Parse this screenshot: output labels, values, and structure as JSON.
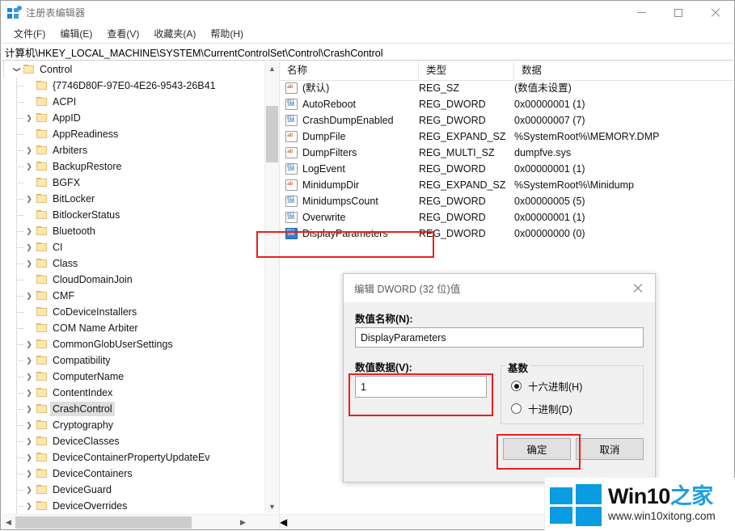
{
  "window": {
    "title": "注册表编辑器",
    "app_icon": "registry-editor-icon",
    "minimize_label": "最小化",
    "maximize_label": "最大化",
    "close_label": "关闭"
  },
  "menubar": {
    "items": [
      {
        "label": "文件(F)"
      },
      {
        "label": "编辑(E)"
      },
      {
        "label": "查看(V)"
      },
      {
        "label": "收藏夹(A)"
      },
      {
        "label": "帮助(H)"
      }
    ]
  },
  "address_bar": {
    "path": "计算机\\HKEY_LOCAL_MACHINE\\SYSTEM\\CurrentControlSet\\Control\\CrashControl"
  },
  "tree": {
    "root": {
      "label": "Control",
      "expanded": true,
      "chevron": "chevron-down-icon"
    },
    "items": [
      {
        "label": "{7746D80F-97E0-4E26-9543-26B41",
        "expandable": false,
        "selected": false
      },
      {
        "label": "ACPI",
        "expandable": false,
        "selected": false
      },
      {
        "label": "AppID",
        "expandable": true,
        "selected": false
      },
      {
        "label": "AppReadiness",
        "expandable": false,
        "selected": false
      },
      {
        "label": "Arbiters",
        "expandable": true,
        "selected": false
      },
      {
        "label": "BackupRestore",
        "expandable": true,
        "selected": false
      },
      {
        "label": "BGFX",
        "expandable": false,
        "selected": false
      },
      {
        "label": "BitLocker",
        "expandable": true,
        "selected": false
      },
      {
        "label": "BitlockerStatus",
        "expandable": false,
        "selected": false
      },
      {
        "label": "Bluetooth",
        "expandable": true,
        "selected": false
      },
      {
        "label": "CI",
        "expandable": true,
        "selected": false
      },
      {
        "label": "Class",
        "expandable": true,
        "selected": false
      },
      {
        "label": "CloudDomainJoin",
        "expandable": false,
        "selected": false
      },
      {
        "label": "CMF",
        "expandable": true,
        "selected": false
      },
      {
        "label": "CoDeviceInstallers",
        "expandable": false,
        "selected": false
      },
      {
        "label": "COM Name Arbiter",
        "expandable": false,
        "selected": false
      },
      {
        "label": "CommonGlobUserSettings",
        "expandable": true,
        "selected": false
      },
      {
        "label": "Compatibility",
        "expandable": true,
        "selected": false
      },
      {
        "label": "ComputerName",
        "expandable": true,
        "selected": false
      },
      {
        "label": "ContentIndex",
        "expandable": true,
        "selected": false
      },
      {
        "label": "CrashControl",
        "expandable": true,
        "selected": true
      },
      {
        "label": "Cryptography",
        "expandable": true,
        "selected": false
      },
      {
        "label": "DeviceClasses",
        "expandable": true,
        "selected": false
      },
      {
        "label": "DeviceContainerPropertyUpdateEv",
        "expandable": true,
        "selected": false
      },
      {
        "label": "DeviceContainers",
        "expandable": true,
        "selected": false
      },
      {
        "label": "DeviceGuard",
        "expandable": true,
        "selected": false
      },
      {
        "label": "DeviceOverrides",
        "expandable": true,
        "selected": false
      }
    ]
  },
  "values": {
    "columns": [
      {
        "label": "名称"
      },
      {
        "label": "类型"
      },
      {
        "label": "数据"
      }
    ],
    "rows": [
      {
        "name": "(默认)",
        "type": "REG_SZ",
        "data": "(数值未设置)",
        "icon": "string-value-icon",
        "selected": false
      },
      {
        "name": "AutoReboot",
        "type": "REG_DWORD",
        "data": "0x00000001 (1)",
        "icon": "dword-value-icon",
        "selected": false
      },
      {
        "name": "CrashDumpEnabled",
        "type": "REG_DWORD",
        "data": "0x00000007 (7)",
        "icon": "dword-value-icon",
        "selected": false
      },
      {
        "name": "DumpFile",
        "type": "REG_EXPAND_SZ",
        "data": "%SystemRoot%\\MEMORY.DMP",
        "icon": "string-value-icon",
        "selected": false
      },
      {
        "name": "DumpFilters",
        "type": "REG_MULTI_SZ",
        "data": "dumpfve.sys",
        "icon": "string-value-icon",
        "selected": false
      },
      {
        "name": "LogEvent",
        "type": "REG_DWORD",
        "data": "0x00000001 (1)",
        "icon": "dword-value-icon",
        "selected": false
      },
      {
        "name": "MinidumpDir",
        "type": "REG_EXPAND_SZ",
        "data": "%SystemRoot%\\Minidump",
        "icon": "string-value-icon",
        "selected": false
      },
      {
        "name": "MinidumpsCount",
        "type": "REG_DWORD",
        "data": "0x00000005 (5)",
        "icon": "dword-value-icon",
        "selected": false
      },
      {
        "name": "Overwrite",
        "type": "REG_DWORD",
        "data": "0x00000001 (1)",
        "icon": "dword-value-icon",
        "selected": false
      },
      {
        "name": "DisplayParameters",
        "type": "REG_DWORD",
        "data": "0x00000000 (0)",
        "icon": "dword-value-icon",
        "selected": true
      }
    ]
  },
  "dialog": {
    "title": "编辑 DWORD (32 位)值",
    "close_label": "关闭",
    "value_name_label": "数值名称(N):",
    "value_name": "DisplayParameters",
    "value_data_label": "数值数据(V):",
    "value_data": "1",
    "base_group_label": "基数",
    "radio_hex": "十六进制(H)",
    "radio_dec": "十进制(D)",
    "radio_selected": "hex",
    "ok_label": "确定",
    "cancel_label": "取消"
  },
  "watermark": {
    "brand_main": "Win10",
    "brand_sub": "之家",
    "url": "www.win10xitong.com",
    "logo_color": "#0a9ce0"
  },
  "annotations": {
    "accent_color": "#ee1c1c",
    "boxes": [
      {
        "name": "highlight-display-parameters-row"
      },
      {
        "name": "highlight-value-data-field"
      },
      {
        "name": "highlight-ok-button"
      }
    ]
  }
}
